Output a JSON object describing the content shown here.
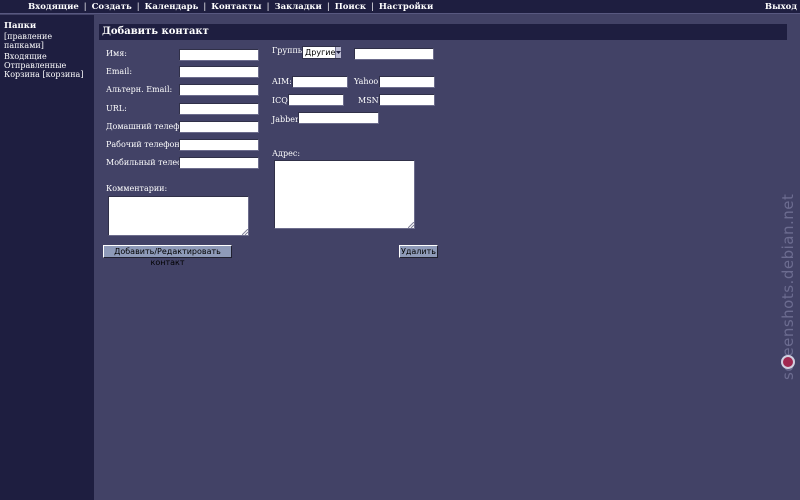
{
  "topbar": {
    "menu": [
      "Входящие",
      "Создать",
      "Календарь",
      "Контакты",
      "Закладки",
      "Поиск",
      "Настройки"
    ],
    "logout": "Выход"
  },
  "sidebar": {
    "title": "Папки",
    "manage": "[правление папками]",
    "folders": [
      "Входящие",
      "Отправленные",
      "Корзина [корзина]"
    ]
  },
  "form": {
    "title": "Добавить контакт",
    "labels": {
      "name": "Имя:",
      "email": "Email:",
      "alt_email": "Альтерн. Email:",
      "url": "URL:",
      "home_phone": "Домашний телефон:",
      "work_phone": "Рабочий телефон:",
      "mobile_phone": "Мобильный телефон:",
      "comments": "Комментарии:",
      "group": "Группы:",
      "aim": "AIM:",
      "yahoo": "Yahoo:",
      "icq": "ICQ:",
      "msn": "MSN:",
      "jabber": "Jabber:",
      "address": "Адрес:"
    },
    "values": {
      "name": "",
      "email": "",
      "alt_email": "",
      "url": "",
      "home_phone": "",
      "work_phone": "",
      "mobile_phone": "",
      "comments": "",
      "group_new": "",
      "aim": "",
      "yahoo": "",
      "icq": "",
      "msn": "",
      "jabber": "",
      "address": ""
    },
    "group_selected": "Другие",
    "buttons": {
      "submit": "Добавить/Редактировать контакт",
      "delete": "Удалить"
    }
  },
  "watermark": "screenshots.debian.net",
  "colors": {
    "background": "#424266",
    "panel": "#1e1e40",
    "button": "#8e9ab8"
  }
}
